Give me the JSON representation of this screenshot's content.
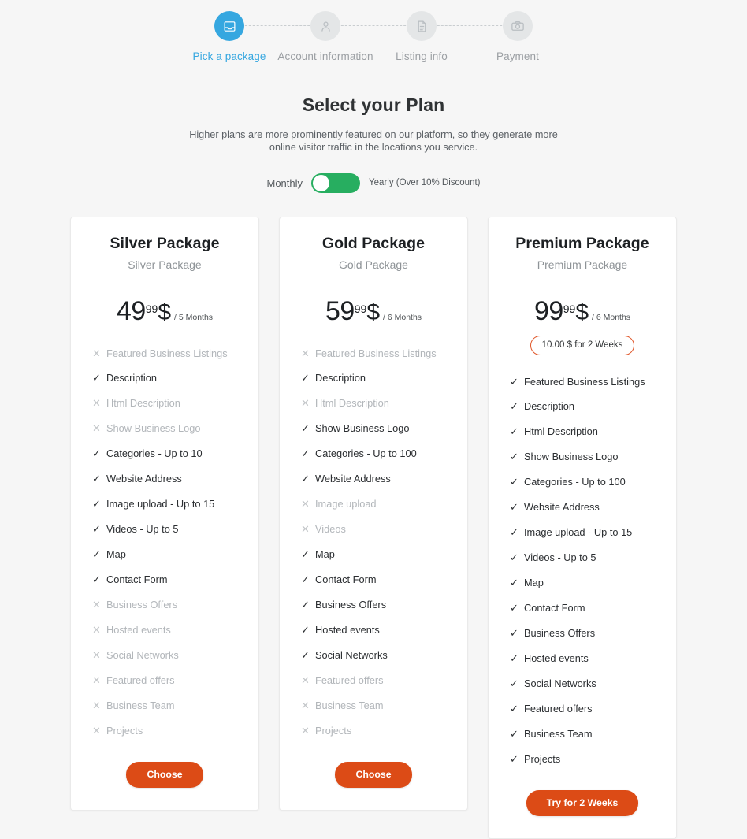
{
  "stepper": {
    "steps": [
      {
        "label": "Pick a package",
        "icon": "inbox-icon",
        "active": true
      },
      {
        "label": "Account information",
        "icon": "person-icon",
        "active": false
      },
      {
        "label": "Listing info",
        "icon": "document-icon",
        "active": false
      },
      {
        "label": "Payment",
        "icon": "camera-icon",
        "active": false
      }
    ],
    "active_color": "#35a7e0",
    "inactive_color": "#9b9fa3"
  },
  "header": {
    "title": "Select your Plan",
    "subtitle": "Higher plans are more prominently featured on our platform, so they generate more online visitor traffic in the locations you service."
  },
  "billing": {
    "monthly_label": "Monthly",
    "yearly_label": "Yearly (Over 10% Discount)",
    "toggle_on": false,
    "toggle_color": "#27ae60"
  },
  "plans": [
    {
      "title": "Silver Package",
      "subtitle": "Silver Package",
      "price_amount": "49",
      "price_cents": "99",
      "price_currency": "$",
      "price_period": "/ 5 Months",
      "trial_badge": null,
      "cta_label": "Choose",
      "features": [
        {
          "label": "Featured Business Listings",
          "enabled": false
        },
        {
          "label": "Description",
          "enabled": true
        },
        {
          "label": "Html Description",
          "enabled": false
        },
        {
          "label": "Show Business Logo",
          "enabled": false
        },
        {
          "label": "Categories - Up to 10",
          "enabled": true
        },
        {
          "label": "Website Address",
          "enabled": true
        },
        {
          "label": "Image upload - Up to 15",
          "enabled": true
        },
        {
          "label": "Videos - Up to 5",
          "enabled": true
        },
        {
          "label": "Map",
          "enabled": true
        },
        {
          "label": "Contact Form",
          "enabled": true
        },
        {
          "label": "Business Offers",
          "enabled": false
        },
        {
          "label": "Hosted events",
          "enabled": false
        },
        {
          "label": "Social Networks",
          "enabled": false
        },
        {
          "label": "Featured offers",
          "enabled": false
        },
        {
          "label": "Business Team",
          "enabled": false
        },
        {
          "label": "Projects",
          "enabled": false
        }
      ]
    },
    {
      "title": "Gold Package",
      "subtitle": "Gold Package",
      "price_amount": "59",
      "price_cents": "99",
      "price_currency": "$",
      "price_period": "/ 6 Months",
      "trial_badge": null,
      "cta_label": "Choose",
      "features": [
        {
          "label": "Featured Business Listings",
          "enabled": false
        },
        {
          "label": "Description",
          "enabled": true
        },
        {
          "label": "Html Description",
          "enabled": false
        },
        {
          "label": "Show Business Logo",
          "enabled": true
        },
        {
          "label": "Categories - Up to 100",
          "enabled": true
        },
        {
          "label": "Website Address",
          "enabled": true
        },
        {
          "label": "Image upload",
          "enabled": false
        },
        {
          "label": "Videos",
          "enabled": false
        },
        {
          "label": "Map",
          "enabled": true
        },
        {
          "label": "Contact Form",
          "enabled": true
        },
        {
          "label": "Business Offers",
          "enabled": true
        },
        {
          "label": "Hosted events",
          "enabled": true
        },
        {
          "label": "Social Networks",
          "enabled": true
        },
        {
          "label": "Featured offers",
          "enabled": false
        },
        {
          "label": "Business Team",
          "enabled": false
        },
        {
          "label": "Projects",
          "enabled": false
        }
      ]
    },
    {
      "title": "Premium Package",
      "subtitle": "Premium Package",
      "price_amount": "99",
      "price_cents": "99",
      "price_currency": "$",
      "price_period": "/ 6 Months",
      "trial_badge": "10.00 $ for 2 Weeks",
      "cta_label": "Try for 2 Weeks",
      "features": [
        {
          "label": "Featured Business Listings",
          "enabled": true
        },
        {
          "label": "Description",
          "enabled": true
        },
        {
          "label": "Html Description",
          "enabled": true
        },
        {
          "label": "Show Business Logo",
          "enabled": true
        },
        {
          "label": "Categories - Up to 100",
          "enabled": true
        },
        {
          "label": "Website Address",
          "enabled": true
        },
        {
          "label": "Image upload - Up to 15",
          "enabled": true
        },
        {
          "label": "Videos - Up to 5",
          "enabled": true
        },
        {
          "label": "Map",
          "enabled": true
        },
        {
          "label": "Contact Form",
          "enabled": true
        },
        {
          "label": "Business Offers",
          "enabled": true
        },
        {
          "label": "Hosted events",
          "enabled": true
        },
        {
          "label": "Social Networks",
          "enabled": true
        },
        {
          "label": "Featured offers",
          "enabled": true
        },
        {
          "label": "Business Team",
          "enabled": true
        },
        {
          "label": "Projects",
          "enabled": true
        }
      ]
    }
  ],
  "marks": {
    "enabled": "✓",
    "disabled": "✕"
  },
  "colors": {
    "accent_orange": "#dc4b16",
    "accent_blue": "#35a7e0",
    "accent_green": "#27ae60",
    "page_background": "#f6f6f6",
    "card_background": "#ffffff"
  }
}
